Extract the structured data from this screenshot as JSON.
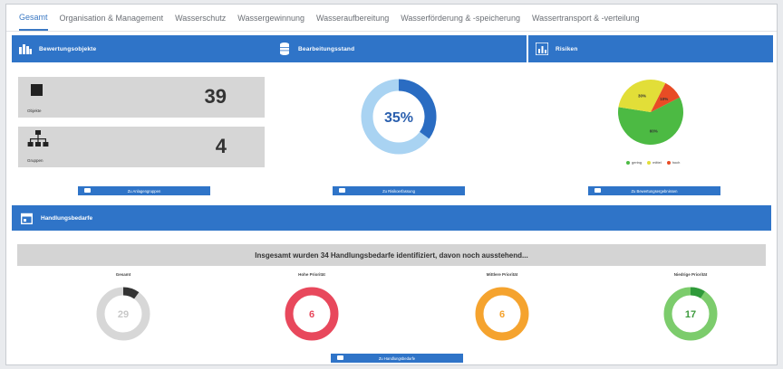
{
  "tabs": [
    {
      "label": "Gesamt",
      "active": true
    },
    {
      "label": "Organisation & Management",
      "active": false
    },
    {
      "label": "Wasserschutz",
      "active": false
    },
    {
      "label": "Wassergewinnung",
      "active": false
    },
    {
      "label": "Wasseraufbereitung",
      "active": false
    },
    {
      "label": "Wasserförderung & -speicherung",
      "active": false
    },
    {
      "label": "Wassertransport & -verteilung",
      "active": false
    }
  ],
  "panels": {
    "objects": {
      "title": "Bewertungsobjekte",
      "objects_value": "39",
      "objects_label": "Objekte",
      "groups_value": "4",
      "groups_label": "Gruppen",
      "button": "Zu Anlagengruppen"
    },
    "progress": {
      "title": "Bearbeitungsstand",
      "percent_label": "35%",
      "percent": 35,
      "button": "Zu Risikoerfassung"
    },
    "risks": {
      "title": "Risiken",
      "slices": [
        {
          "label": "gering",
          "value": 60,
          "text": "60%",
          "color": "#4cba43"
        },
        {
          "label": "mittel",
          "value": 30,
          "text": "30%",
          "color": "#e2de38"
        },
        {
          "label": "hoch",
          "value": 10,
          "text": "10%",
          "color": "#e84c25"
        }
      ],
      "button": "Zu Bewertungsergebnissen"
    }
  },
  "handlung": {
    "title": "Handlungsbedarfe",
    "summary": "Insgesamt wurden 34 Handlungsbedarfe identifiziert, davon noch ausstehend...",
    "button": "Zu Handlungsbedarfe",
    "donuts": [
      {
        "label": "Gesamt",
        "value": "29",
        "fraction": 0.1,
        "track": "#d7d7d7",
        "fill": "#333333",
        "text_color": "#c8c8c8"
      },
      {
        "label": "Hohe Priorität",
        "value": "6",
        "fraction": 1.0,
        "track": "#e8485c",
        "fill": "#e8485c",
        "text_color": "#e8485c"
      },
      {
        "label": "Mittlere Priorität",
        "value": "6",
        "fraction": 1.0,
        "track": "#f5a32e",
        "fill": "#f5a32e",
        "text_color": "#f5a32e"
      },
      {
        "label": "Niedrige Priorität",
        "value": "17",
        "fraction": 0.09,
        "track": "#7ccc6c",
        "fill": "#2f9a3a",
        "text_color": "#3c9a3c"
      }
    ]
  },
  "colors": {
    "primary": "#2f74c8",
    "progress_fill": "#2a6cc2",
    "progress_track": "#a9d3f2"
  }
}
